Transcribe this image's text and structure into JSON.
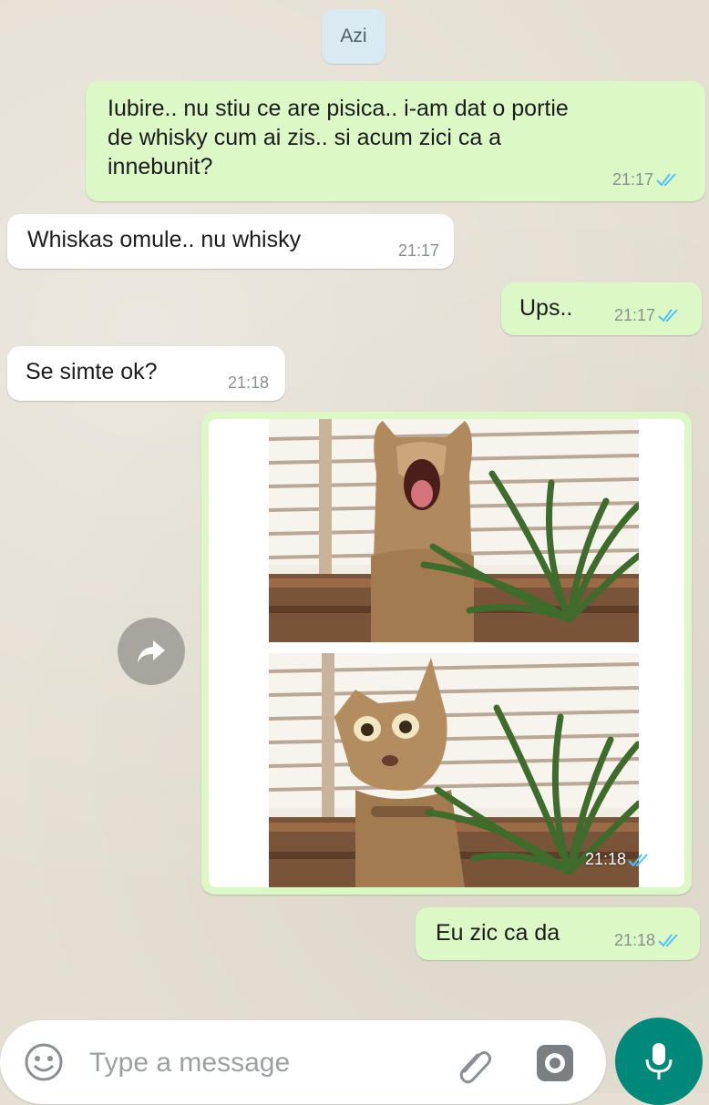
{
  "chat": {
    "date_chip": "Azi",
    "messages": [
      {
        "dir": "out",
        "text": "Iubire.. nu stiu ce are pisica.. i-am dat o portie\nde whisky cum ai zis.. si acum zici ca a\ninnebunit?",
        "time": "21:17",
        "status": "read"
      },
      {
        "dir": "in",
        "text": "Whiskas omule.. nu whisky",
        "time": "21:17"
      },
      {
        "dir": "out",
        "text": "Ups..",
        "time": "21:17",
        "status": "read"
      },
      {
        "dir": "in",
        "text": "Se simte ok?",
        "time": "21:18"
      },
      {
        "dir": "out",
        "type": "image",
        "time": "21:18",
        "status": "read"
      },
      {
        "dir": "out",
        "text": "Eu zic ca da",
        "time": "21:18",
        "status": "read"
      }
    ]
  },
  "composer": {
    "placeholder": "Type a message",
    "icons": [
      "emoji-icon",
      "attach-icon",
      "camera-icon",
      "mic-icon"
    ]
  },
  "colors": {
    "outgoing_bubble": "#dcf8c6",
    "incoming_bubble": "#ffffff",
    "read_ticks": "#4fc3f7",
    "mic_button": "#00897b"
  }
}
